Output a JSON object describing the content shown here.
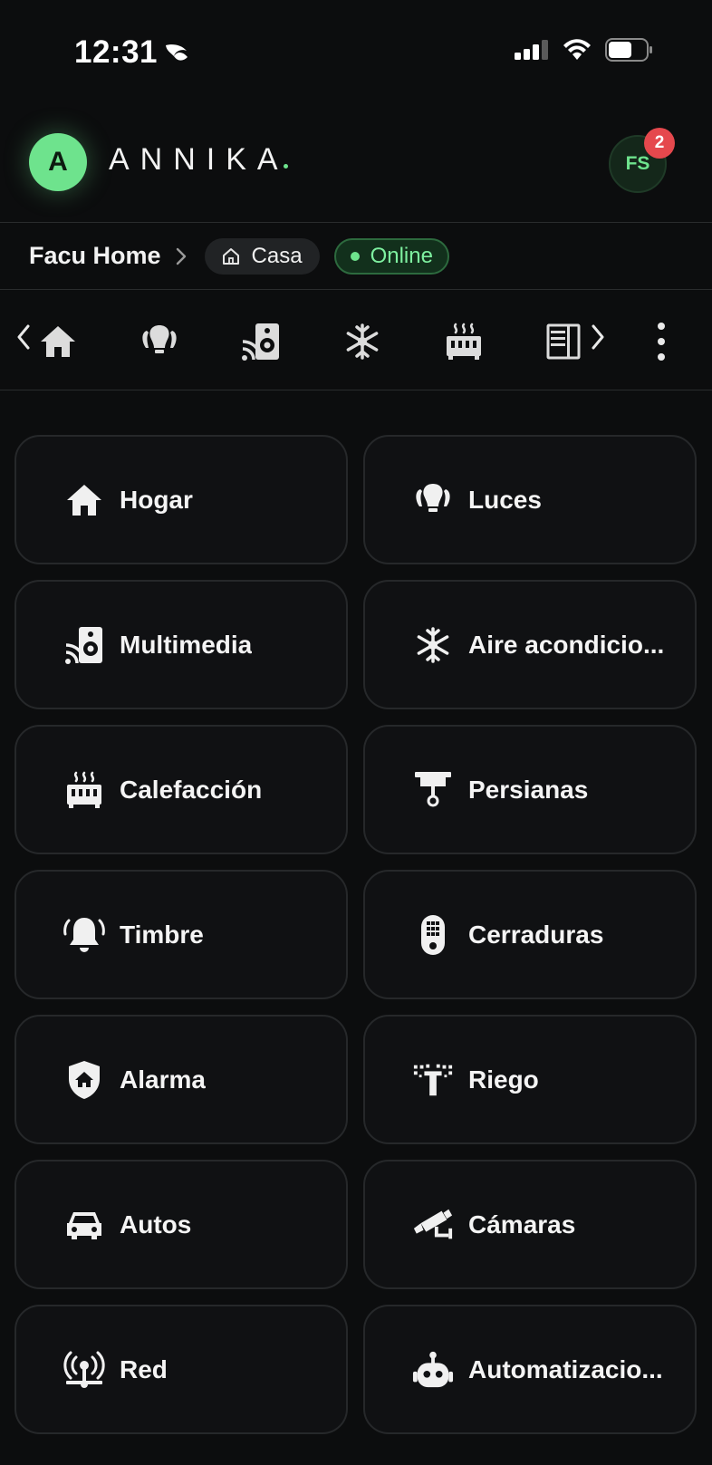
{
  "status_bar": {
    "time": "12:31",
    "icons": [
      "sleep-focus-icon",
      "cellular-signal-icon",
      "wifi-icon",
      "battery-icon"
    ]
  },
  "header": {
    "avatar_letter": "A",
    "brand": "ANNIKA",
    "user_initials": "FS",
    "notification_count": "2",
    "accent": "#6ee38d"
  },
  "breadcrumb": {
    "home": "Facu Home",
    "location": "Casa",
    "status": "Online"
  },
  "tabs": [
    "home-icon",
    "lightbulbs-icon",
    "speaker-icon",
    "snowflake-icon",
    "heater-icon",
    "blinds-icon"
  ],
  "categories": [
    {
      "label": "Hogar",
      "icon": "home-icon"
    },
    {
      "label": "Luces",
      "icon": "lightbulbs-icon"
    },
    {
      "label": "Multimedia",
      "icon": "speaker-icon"
    },
    {
      "label": "Aire acondicio...",
      "icon": "snowflake-icon"
    },
    {
      "label": "Calefacción",
      "icon": "heater-icon"
    },
    {
      "label": "Persianas",
      "icon": "blinds-icon"
    },
    {
      "label": "Timbre",
      "icon": "bell-icon"
    },
    {
      "label": "Cerraduras",
      "icon": "keypad-lock-icon"
    },
    {
      "label": "Alarma",
      "icon": "shield-home-icon"
    },
    {
      "label": "Riego",
      "icon": "sprinkler-icon"
    },
    {
      "label": "Autos",
      "icon": "car-icon"
    },
    {
      "label": "Cámaras",
      "icon": "cctv-icon"
    },
    {
      "label": "Red",
      "icon": "network-icon"
    },
    {
      "label": "Automatizacio...",
      "icon": "robot-icon"
    }
  ]
}
